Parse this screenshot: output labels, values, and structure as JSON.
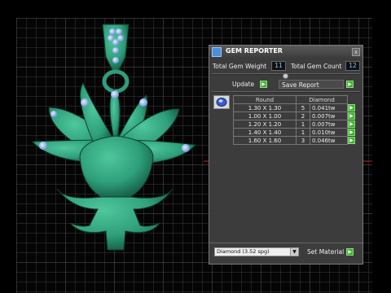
{
  "panel": {
    "title": "GEM REPORTER",
    "close_label": "x",
    "total_weight_label": "Total Gem Weight",
    "total_weight_value": "11",
    "total_count_label": "Total Gem Count",
    "total_count_value": "12",
    "update_label": "Update",
    "save_report_label": "Save Report",
    "table": {
      "headers": [
        "Round",
        "Diamond"
      ],
      "rows": [
        {
          "size": "1.30 X 1.30",
          "count": "5",
          "weight": "0.041tw"
        },
        {
          "size": "1.00 X 1.00",
          "count": "2",
          "weight": "0.007tw"
        },
        {
          "size": "1.20 X 1.20",
          "count": "1",
          "weight": "0.007tw"
        },
        {
          "size": "1.40 X 1.40",
          "count": "1",
          "weight": "0.010tw"
        },
        {
          "size": "1.60 X 1.60",
          "count": "3",
          "weight": "0.046tw"
        }
      ]
    },
    "material_select": "Diamond   (3.52 spg)",
    "set_material_label": "Set Material"
  },
  "colors": {
    "jewel_green": "#2e9f7a",
    "gem_blue": "#9fc2f0",
    "accent_green": "#3bb32a",
    "value_blue": "#7ecbff"
  },
  "icons": {
    "app": "app-icon",
    "close": "close-icon",
    "go": "green-arrow-icon",
    "gem_shape": "round-gem-icon"
  }
}
